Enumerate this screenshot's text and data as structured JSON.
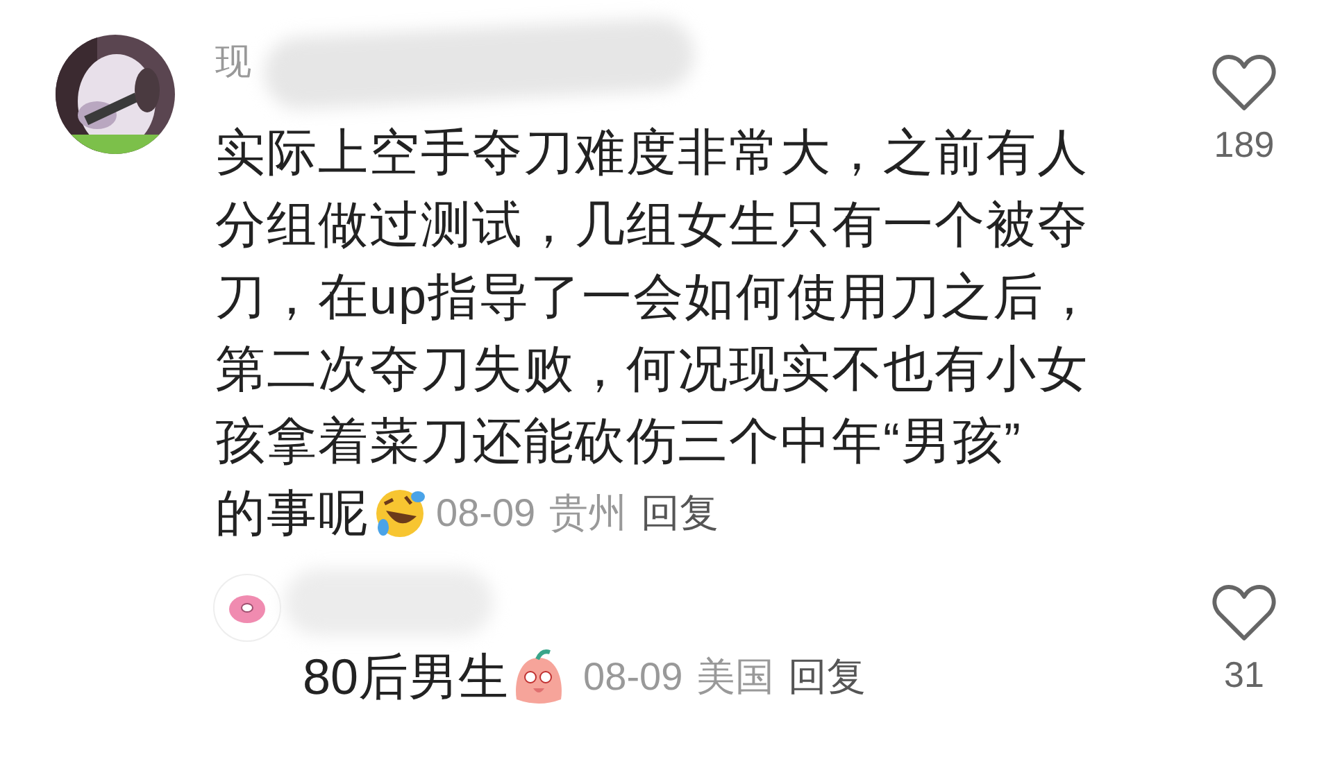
{
  "comments": [
    {
      "username": "现",
      "text_lines": [
        "实际上空手夺刀难度非常大，之前有人",
        "分组做过测试，几组女生只有一个被夺",
        "刀，在up指导了一会如何使用刀之后，",
        "第二次夺刀失败，何况现实不也有小女",
        "孩拿着菜刀还能砍伤三个中年“男孩”",
        "的事呢"
      ],
      "date": "08-09",
      "location": "贵州",
      "reply_label": "回复",
      "likes": "189",
      "liked": false,
      "replies": [
        {
          "text": "80后男生",
          "date": "08-09",
          "location": "美国",
          "reply_label": "回复",
          "likes": "31",
          "liked": false
        }
      ]
    }
  ]
}
